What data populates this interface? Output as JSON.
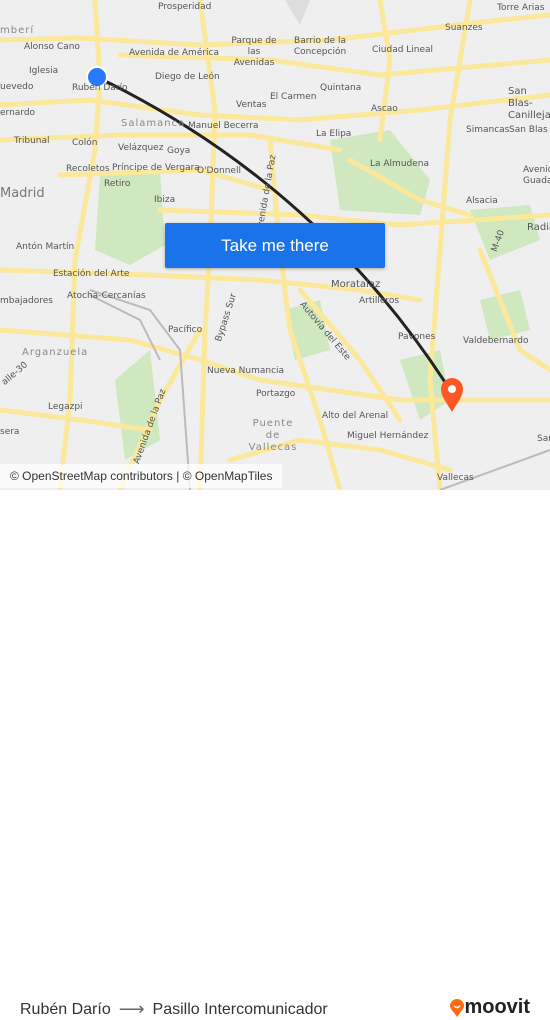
{
  "map": {
    "labels": [
      "Prosperidad",
      "Torre Arias",
      "mberí",
      "Alonso Cano",
      "Parque de las Avenidas",
      "Barrio de la Concepción",
      "Suanzes",
      "Avenida de América",
      "Ciudad Lineal",
      "Iglesia",
      "Diego de León",
      "Rubén Darío",
      "uevedo",
      "Quintana",
      "San Blas-Canillejas",
      "El Carmen",
      "Ventas",
      "Ascao",
      "ernardo",
      "Salamanca",
      "Manuel Becerra",
      "La Elipa",
      "Simancas",
      "San Blas",
      "Tribunal",
      "Colón",
      "Velázquez",
      "Goya",
      "La Almudena",
      "Recoletos",
      "Príncipe de Vergara",
      "O'Donnell",
      "Avenida Guadal",
      "Madrid",
      "Retiro",
      "Ibiza",
      "Alsacia",
      "Radia",
      "M-40",
      "Antón Martín",
      "Estación del Arte",
      "Moratalaz",
      "Artilleros",
      "mbajadores",
      "Atocha-Cercanías",
      "Bypass Sur",
      "Autovía del Este",
      "Avenida de la Paz",
      "Valdebernardo",
      "Pacífico",
      "Pavones",
      "Arganzuela",
      "alle-30",
      "Nueva Numancia",
      "Legazpi",
      "Portazgo",
      "Avenida de la Paz",
      "Puente de Vallecas",
      "Alto del Arenal",
      "Miguel Hernández",
      "sera",
      "San",
      "Vallecas"
    ],
    "attribution": "© OpenStreetMap contributors | © OpenMapTiles",
    "cta_label": "Take me there",
    "origin_color": "#2979ff",
    "destination_color": "#ff5722",
    "route_color": "#222222"
  },
  "footer": {
    "origin": "Rubén Darío",
    "arrow": "⟶",
    "destination": "Pasillo Intercomunicador",
    "brand": "moovit",
    "brand_color": "#ff6a13"
  }
}
